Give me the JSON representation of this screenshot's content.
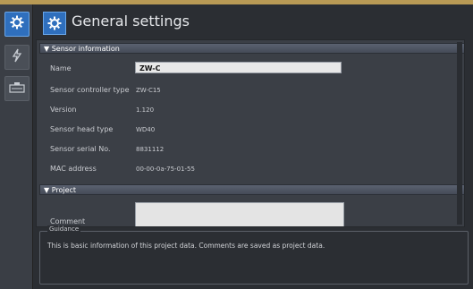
{
  "header": {
    "title": "General settings"
  },
  "sections": {
    "sensor_information": "▼ Sensor information",
    "project": "▼ Project"
  },
  "fields": {
    "name_label": "Name",
    "name_value": "ZW-C",
    "controller_type_label": "Sensor controller type",
    "controller_type_value": "ZW-C15",
    "version_label": "Version",
    "version_value": "1.120",
    "head_type_label": "Sensor head type",
    "head_type_value": "WD40",
    "serial_label": "Sensor serial No.",
    "serial_value": "8831112",
    "mac_label": "MAC address",
    "mac_value": "00-00-0a-75-01-55",
    "comment_label": "Comment"
  },
  "guidance": {
    "title": "Guidance",
    "text": "This is basic information of this project data. Comments are saved as project data."
  },
  "icons": {
    "rail": [
      "gear-icon",
      "lightning-icon",
      "controller-icon"
    ],
    "header": "gear-icon"
  },
  "colors": {
    "accent": "#2f6fbd",
    "top_line": "#b89a55"
  }
}
